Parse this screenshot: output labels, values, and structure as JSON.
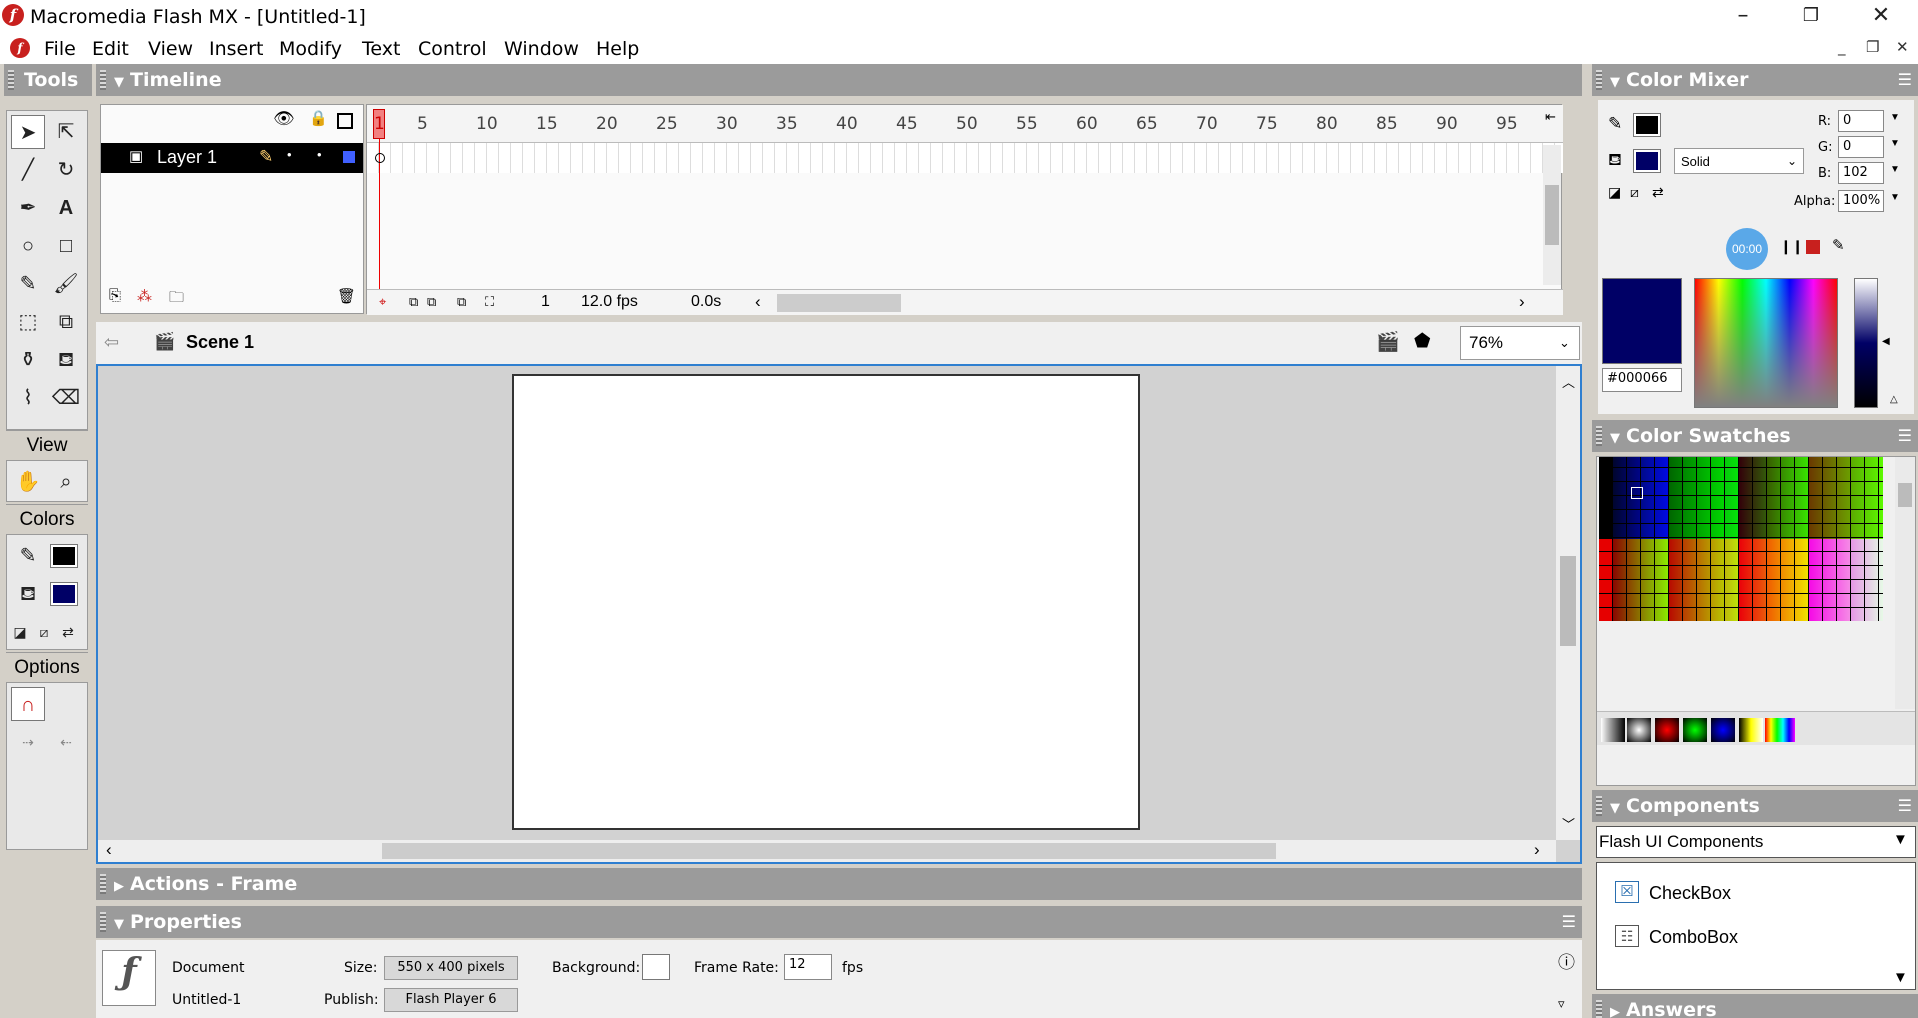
{
  "window": {
    "title": "Macromedia Flash MX - [Untitled-1]",
    "controls": [
      "–",
      "❐",
      "✕"
    ]
  },
  "menu": {
    "items": [
      "File",
      "Edit",
      "View",
      "Insert",
      "Modify",
      "Text",
      "Control",
      "Window",
      "Help"
    ],
    "mdi_controls": [
      "_",
      "❐",
      "✕"
    ]
  },
  "tools": {
    "title": "Tools",
    "view_label": "View",
    "colors_label": "Colors",
    "options_label": "Options"
  },
  "timeline": {
    "title": "Timeline",
    "layer_name": "Layer 1",
    "frame_numbers": [
      "1",
      "5",
      "10",
      "15",
      "20",
      "25",
      "30",
      "35",
      "40",
      "45",
      "50",
      "55",
      "60",
      "65",
      "70",
      "75",
      "80",
      "85",
      "90",
      "95"
    ],
    "current_frame": "1",
    "fps": "12.0 fps",
    "elapsed": "0.0s"
  },
  "stage": {
    "scene": "Scene 1",
    "zoom": "76%"
  },
  "color_mixer": {
    "title": "Color Mixer",
    "fill_style": "Solid",
    "r_label": "R:",
    "r": "0",
    "g_label": "G:",
    "g": "0",
    "b_label": "B:",
    "b": "102",
    "alpha_label": "Alpha:",
    "alpha": "100%",
    "hex": "#000066",
    "recording_time": "00:00",
    "fill_color": "#000066"
  },
  "swatches": {
    "title": "Color Swatches"
  },
  "components": {
    "title": "Components",
    "set": "Flash UI Components",
    "items": [
      "CheckBox",
      "ComboBox"
    ]
  },
  "answers": {
    "title": "Answers"
  },
  "actions": {
    "title": "Actions - Frame"
  },
  "properties": {
    "title": "Properties",
    "doc_label": "Document",
    "doc_name": "Untitled-1",
    "size_label": "Size:",
    "size_value": "550 x 400 pixels",
    "publish_label": "Publish:",
    "publish_value": "Flash Player 6",
    "bg_label": "Background:",
    "framerate_label": "Frame Rate:",
    "framerate_value": "12",
    "fps_label": "fps"
  }
}
